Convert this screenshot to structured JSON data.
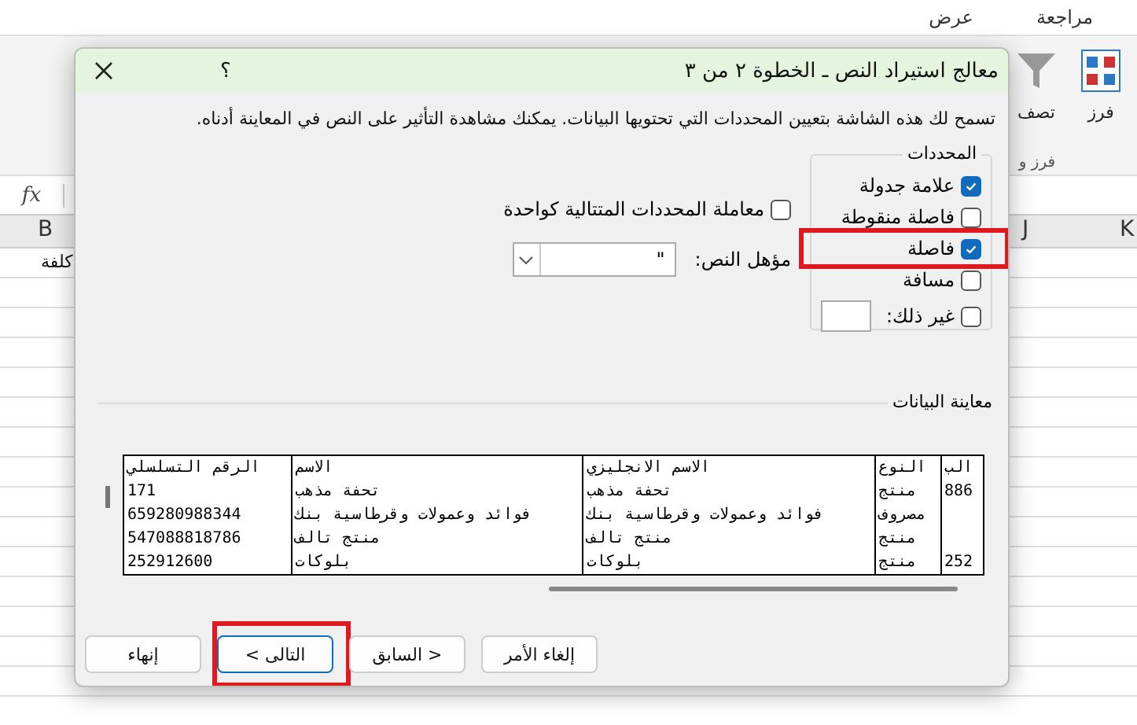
{
  "excel": {
    "ribbon_tabs": [
      "مراجعة",
      "عرض"
    ],
    "ribbon_buttons": [
      {
        "label": "فرز",
        "kind": "sort"
      },
      {
        "label": "تصف",
        "kind": "filter"
      }
    ],
    "ribbon_group": "فرز و",
    "formula_label": "fx",
    "column_headers": [
      "K",
      "J",
      "B"
    ],
    "cell": "كلفة"
  },
  "dialog": {
    "title": "معالج استيراد النص ـ الخطوة ٢ من ٣",
    "help": "؟",
    "description": "تسمح لك هذه الشاشة بتعيين المحددات التي تحتويها البيانات. يمكنك مشاهدة التأثير على النص في المعاينة أدناه.",
    "delimiters": {
      "title": "المحددات",
      "items": [
        {
          "label": "علامة جدولة",
          "checked": true,
          "highlighted": false,
          "kind": "option"
        },
        {
          "label": "فاصلة منقوطة",
          "checked": false,
          "highlighted": false,
          "kind": "option"
        },
        {
          "label": "فاصلة",
          "checked": true,
          "highlighted": true,
          "kind": "option"
        },
        {
          "label": "مسافة",
          "checked": false,
          "highlighted": false,
          "kind": "option"
        },
        {
          "label": "غير ذلك:",
          "checked": false,
          "highlighted": false,
          "kind": "other"
        }
      ]
    },
    "consecutive": {
      "label": "معاملة المحددات المتتالية كواحدة",
      "checked": false
    },
    "qualifier": {
      "label": "مؤهل النص:",
      "value": "\""
    },
    "preview": {
      "title": "معاينة البيانات",
      "header": [
        "الب",
        "النوع",
        "الاسم الانجليزي",
        "الاسم",
        "الرقم التسلسلي"
      ],
      "rows": [
        [
          "886",
          "منتج",
          "تحفة مذهب",
          "تحفة مذهب",
          "171"
        ],
        [
          null,
          "مصروف",
          "فوائد وعمولات وقرطاسية بنك",
          "فوائد وعمولات وقرطاسية بنك",
          "659280988344"
        ],
        [
          null,
          "منتج",
          "منتج تالف",
          "منتج تالف",
          "547088818786"
        ],
        [
          "252",
          "منتج",
          "بلوكات",
          "بلوكات",
          "252912600"
        ]
      ]
    },
    "buttons": [
      {
        "label": "إلغاء الأمر",
        "default": false,
        "highlighted": false
      },
      {
        "label": "< السابق",
        "default": false,
        "highlighted": false
      },
      {
        "label": "التالى >",
        "default": true,
        "highlighted": true
      },
      {
        "label": "إنهاء",
        "default": false,
        "highlighted": false
      }
    ]
  }
}
